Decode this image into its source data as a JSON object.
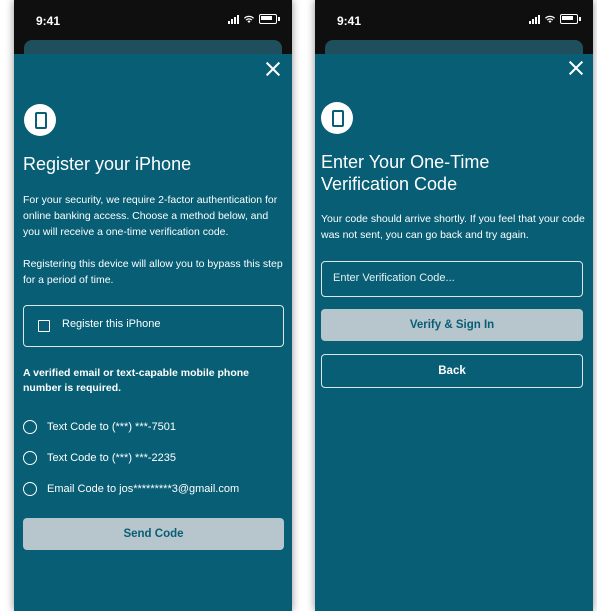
{
  "status_bar": {
    "time": "9:41"
  },
  "register_screen": {
    "title": "Register your iPhone",
    "paragraph1": "For your security, we require 2-factor authentication for online banking access. Choose a method below, and you will receive a one-time verification code.",
    "paragraph2": "Registering this device will allow you to bypass this step for a period of time.",
    "checkbox_label": "Register this iPhone",
    "requirement_text": "A verified email or text-capable mobile phone number is required.",
    "options": [
      {
        "label": "Text Code to (***) ***-7501"
      },
      {
        "label": "Text Code to (***) ***-2235"
      },
      {
        "label": "Email Code to jos*********3@gmail.com"
      }
    ],
    "send_button": "Send Code"
  },
  "verify_screen": {
    "title": "Enter Your One-Time Verification Code",
    "paragraph": "Your code should arrive shortly. If you feel that your code was not sent, you can go back and try again.",
    "input_placeholder": "Enter Verification Code...",
    "verify_button": "Verify & Sign In",
    "back_button": "Back"
  },
  "colors": {
    "sheet": "#075e75",
    "button_disabled": "#b7c5cc",
    "frame": "#0f0f10"
  }
}
